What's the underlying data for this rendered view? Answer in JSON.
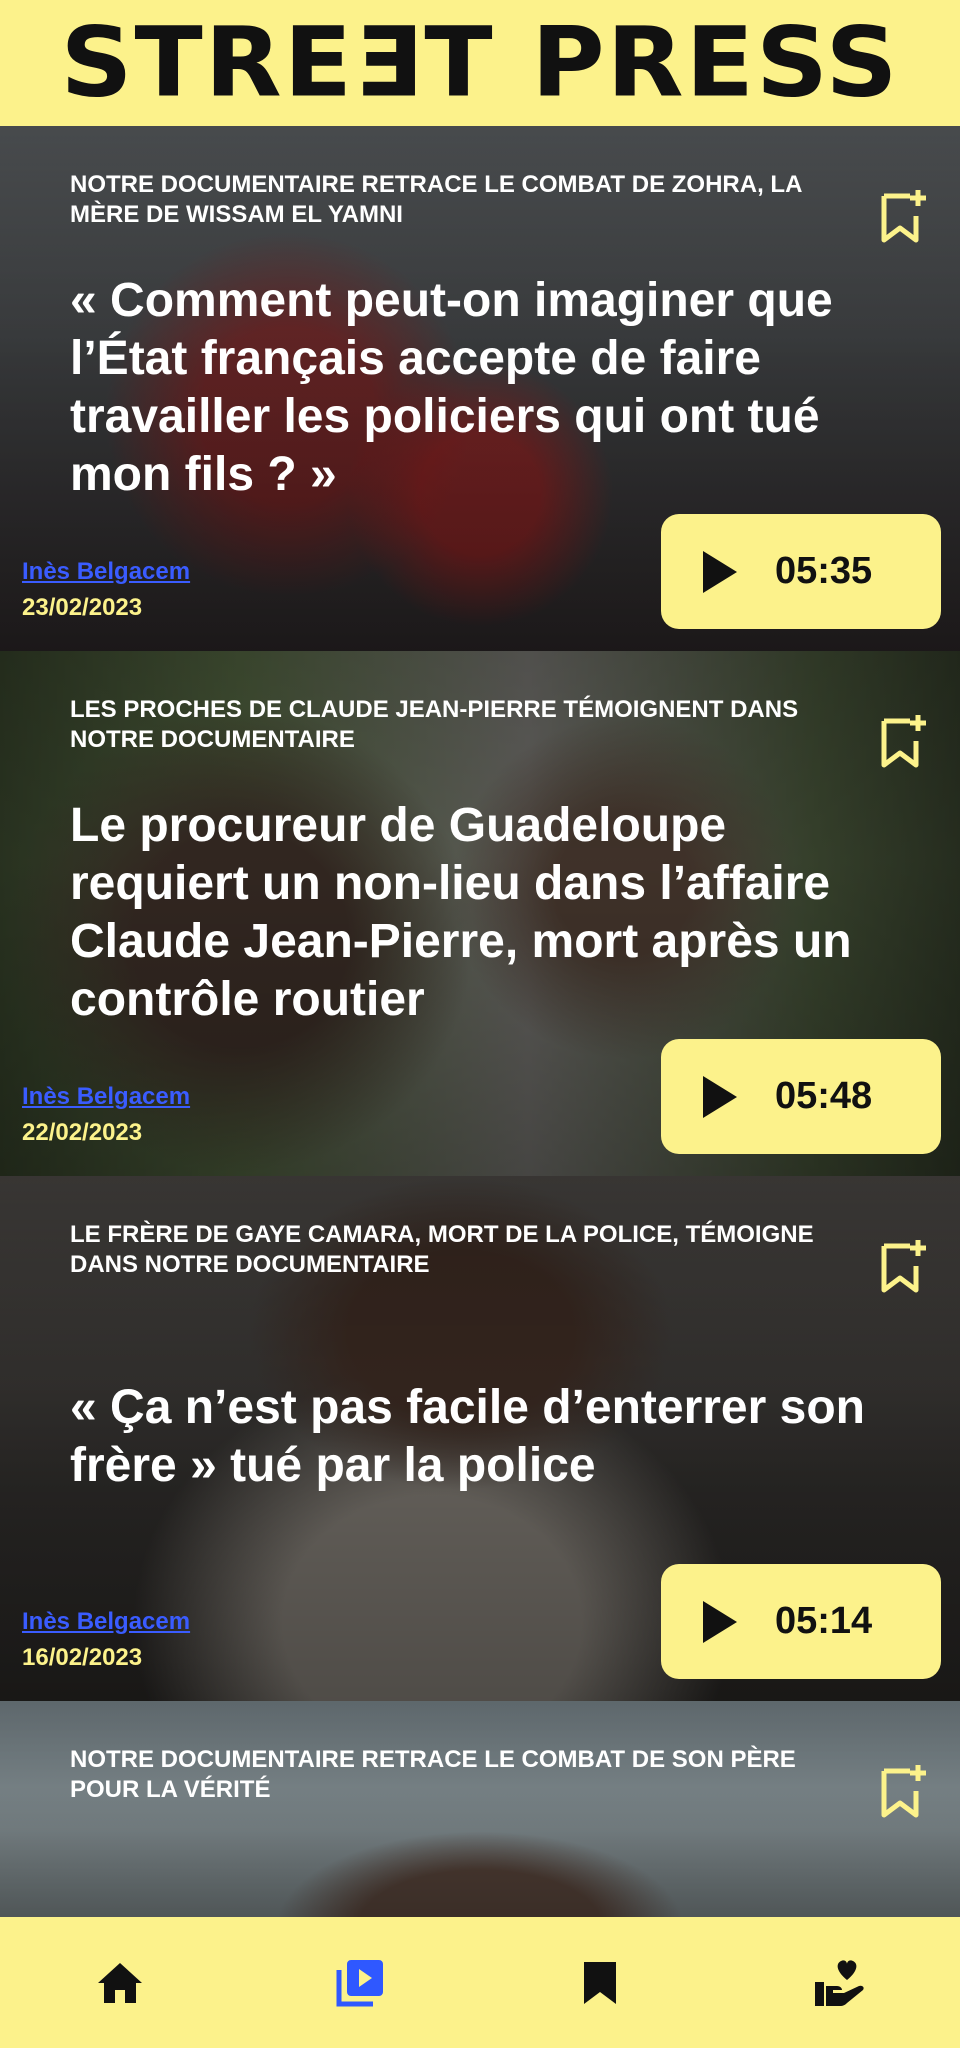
{
  "header": {
    "logo": "STREƎT PRESS"
  },
  "articles": [
    {
      "kicker": "NOTRE DOCUMENTAIRE RETRACE LE COMBAT DE ZOHRA, LA MÈRE DE WISSAM EL YAMNI",
      "headline": "« Comment peut-on imaginer que l’État français accepte de faire travailler les policiers qui ont tué mon fils ? »",
      "author": "Inès Belgacem",
      "date": "23/02/2023",
      "duration": "05:35"
    },
    {
      "kicker": "LES PROCHES DE CLAUDE JEAN-PIERRE TÉMOIGNENT DANS NOTRE DOCUMENTAIRE",
      "headline": "Le procureur de Guadeloupe requiert un non-lieu dans l’affaire Claude Jean-Pierre, mort après un contrôle routier",
      "author": "Inès Belgacem",
      "date": "22/02/2023",
      "duration": "05:48"
    },
    {
      "kicker": "LE FRÈRE DE GAYE CAMARA, MORT DE LA POLICE, TÉMOIGNE DANS NOTRE DOCUMENTAIRE",
      "headline": "« Ça n’est pas facile d’enterrer son frère » tué par la police",
      "author": "Inès Belgacem",
      "date": "16/02/2023",
      "duration": "05:14"
    },
    {
      "kicker": "NOTRE DOCUMENTAIRE RETRACE LE COMBAT DE SON PÈRE POUR LA VÉRITÉ"
    }
  ],
  "nav": {
    "items": [
      {
        "icon": "home-icon",
        "active": false
      },
      {
        "icon": "video-library-icon",
        "active": true
      },
      {
        "icon": "bookmark-icon",
        "active": false
      },
      {
        "icon": "donate-heart-icon",
        "active": false
      }
    ],
    "active_color": "#2f58ff",
    "color": "#111111"
  },
  "colors": {
    "accent": "#fcf28b",
    "author_link": "#3a5cff"
  }
}
